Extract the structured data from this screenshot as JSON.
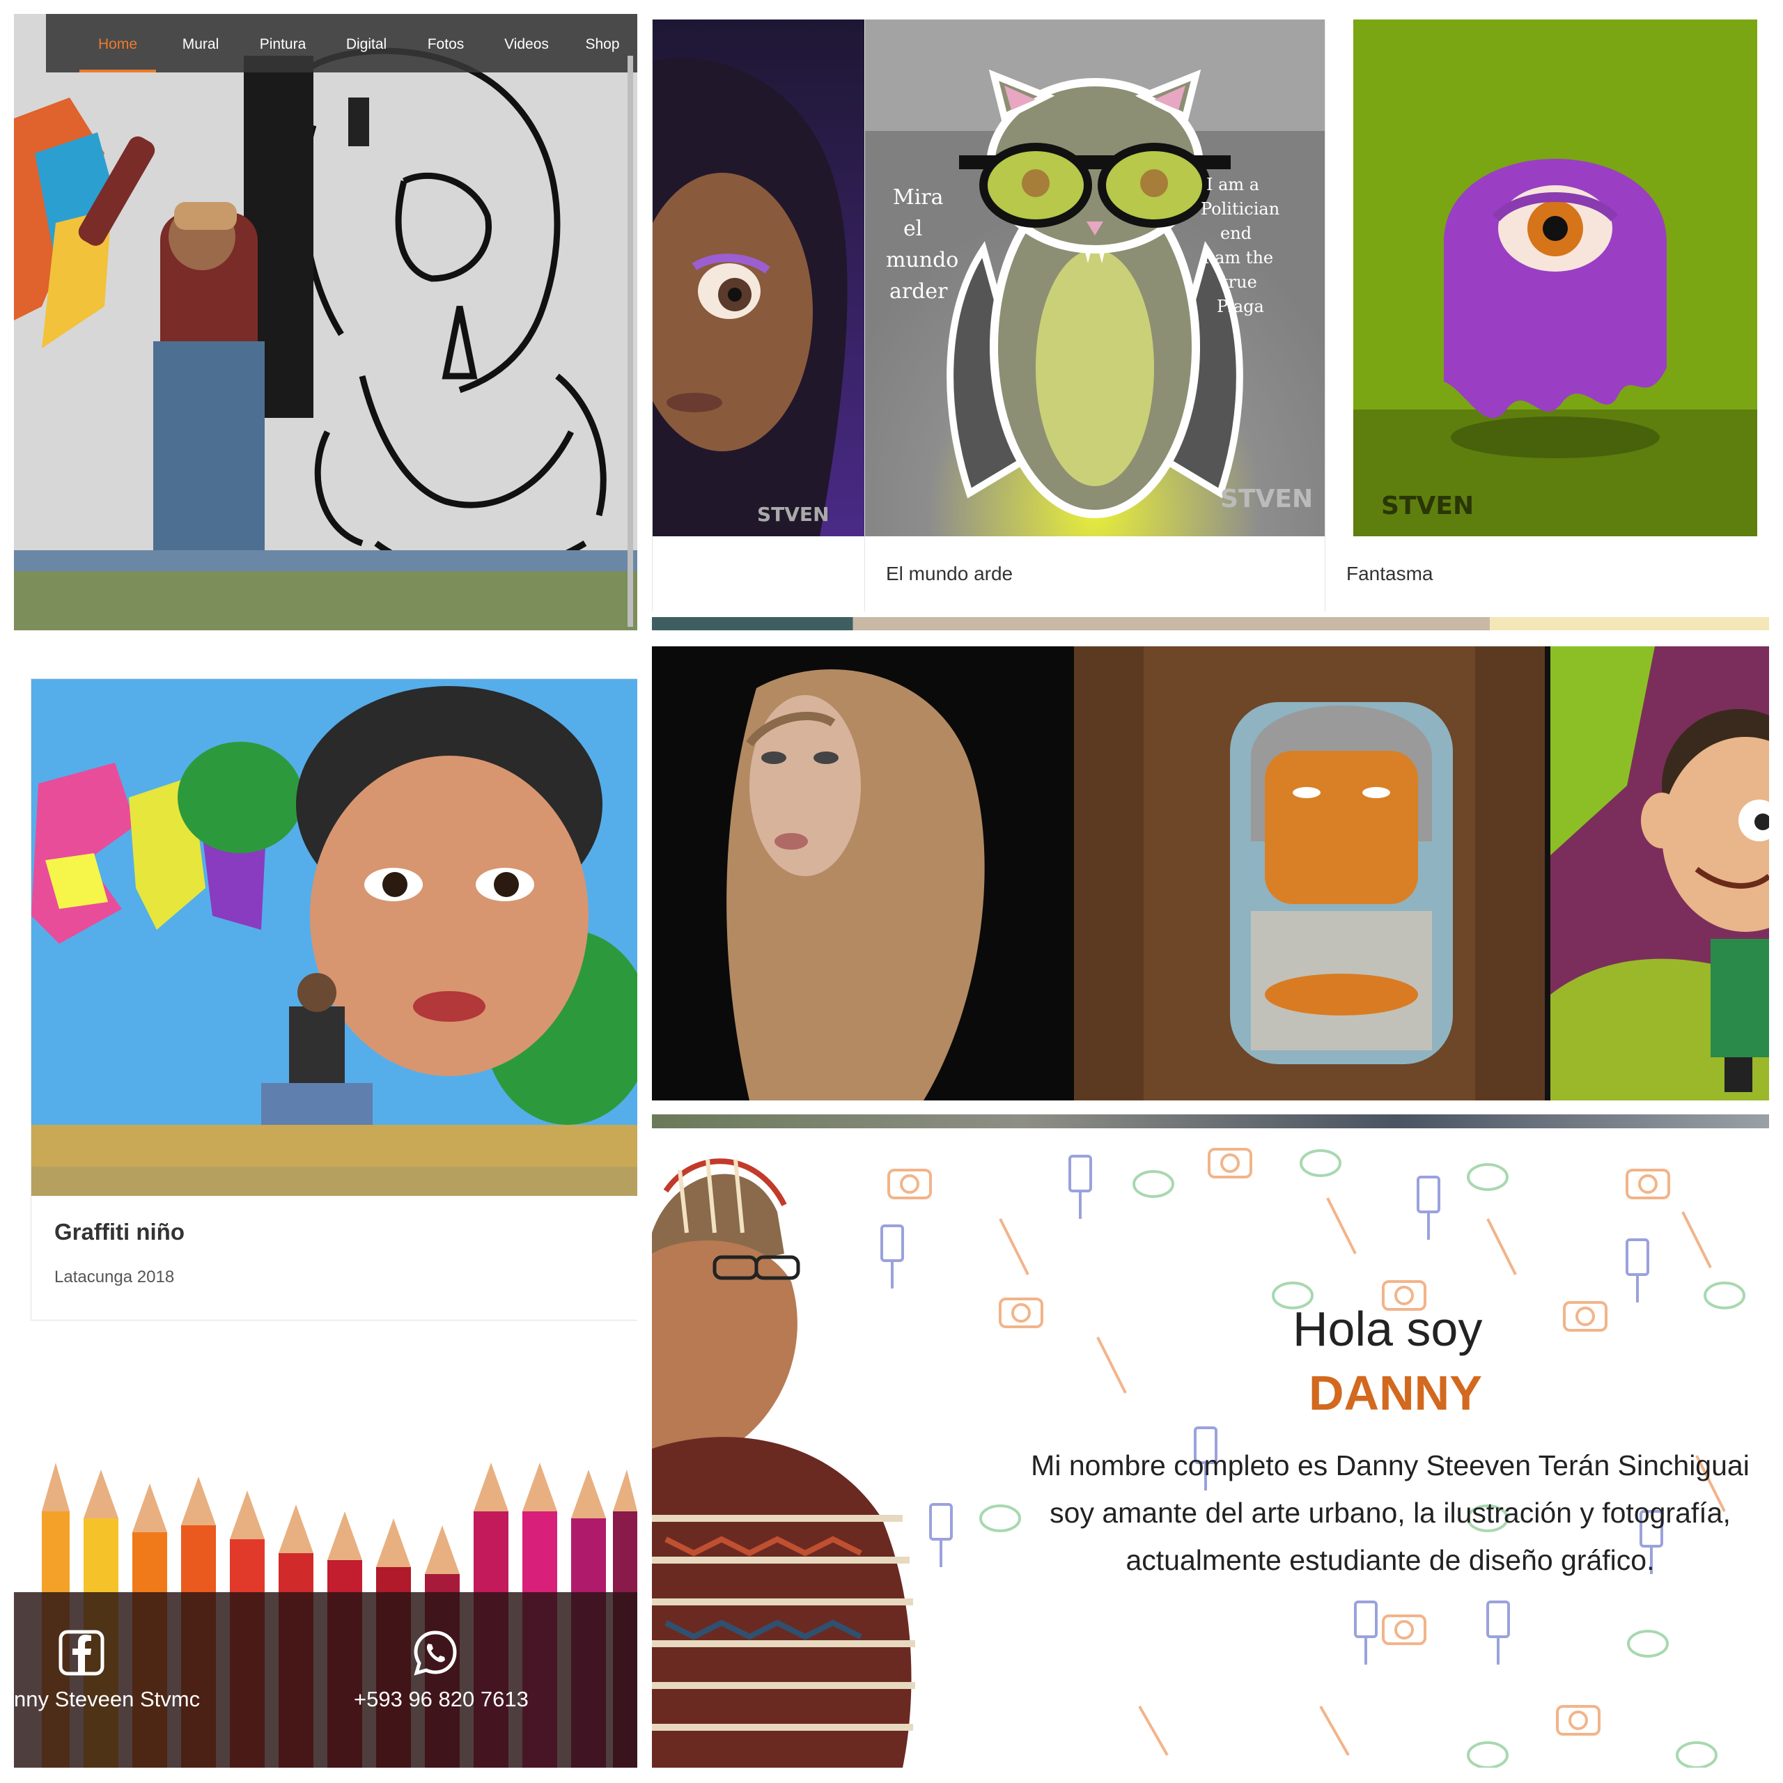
{
  "nav": {
    "items": [
      {
        "label": "Home",
        "active": true
      },
      {
        "label": "Mural"
      },
      {
        "label": "Pintura"
      },
      {
        "label": "Digital"
      },
      {
        "label": "Fotos"
      },
      {
        "label": "Videos"
      },
      {
        "label": "Shop"
      }
    ],
    "active_color": "#f07a2a"
  },
  "gallery": {
    "cards": [
      {
        "caption": ""
      },
      {
        "caption": "El mundo arde"
      },
      {
        "caption": "Fantasma"
      }
    ],
    "bat_text_left": "Mira el mundo arder",
    "bat_text_right": "I am a Politician end I am the true Plaga",
    "watermark": "STVEN DANNY"
  },
  "graffiti_card": {
    "title": "Graffiti niño",
    "subtitle": "Latacunga 2018"
  },
  "footer": {
    "facebook_label": "nny Steveen Stvmc",
    "whatsapp_label": "+593 96 820 7613",
    "icons": [
      "facebook-icon",
      "whatsapp-icon"
    ]
  },
  "about": {
    "greeting": "Hola soy",
    "name": "DANNY",
    "name_color": "#d2691e",
    "bio_lines": [
      "Mi nombre completo es Danny Steeven Terán Sinchiguai",
      "soy amante del arte urbano, la ilustración y fotografía,",
      "actualmente estudiante de diseño gráfico."
    ]
  }
}
